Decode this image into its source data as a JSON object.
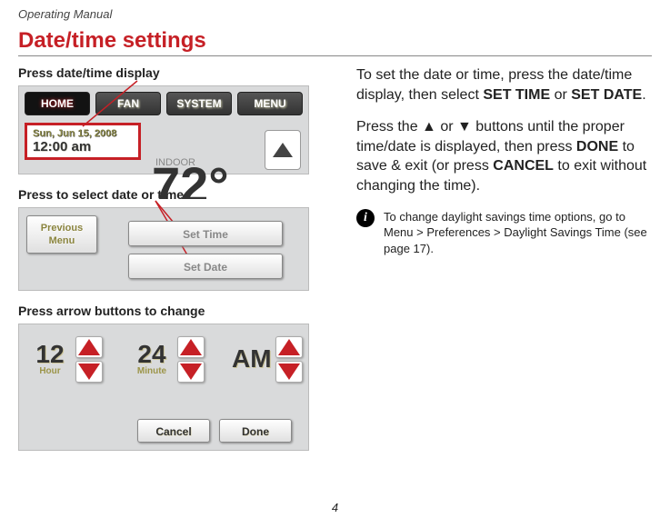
{
  "header": {
    "manual": "Operating Manual",
    "title": "Date/time settings",
    "page_number": "4"
  },
  "captions": {
    "c1": "Press date/time display",
    "c2": "Press to select date or time",
    "c3": "Press arrow buttons to change"
  },
  "screenshot1": {
    "tabs": {
      "home": "HOME",
      "fan": "FAN",
      "system": "SYSTEM",
      "menu": "MENU"
    },
    "date": "Sun, Jun 15, 2008",
    "time": "12:00 am",
    "indoor_label": "INDOOR",
    "temp": "72°"
  },
  "screenshot2": {
    "prev": "Previous\nMenu",
    "set_time": "Set Time",
    "set_date": "Set Date"
  },
  "screenshot3": {
    "hour_val": "12",
    "hour_label": "Hour",
    "minute_val": "24",
    "minute_label": "Minute",
    "ampm": "AM",
    "cancel": "Cancel",
    "done": "Done"
  },
  "instructions": {
    "p1a": "To set the date or time, press the date/time display, then select ",
    "p1b": "SET TIME",
    "p1c": " or ",
    "p1d": "SET DATE",
    "p1e": ".",
    "p2a": "Press the ▲ or ▼ buttons until the proper time/date is displayed, then press ",
    "p2b": "DONE",
    "p2c": " to save & exit (or press ",
    "p2d": "CANCEL",
    "p2e": " to exit without changing the time).",
    "tip": "To change daylight savings time options, go to Menu > Preferences > Daylight Savings Time (see page 17)."
  }
}
